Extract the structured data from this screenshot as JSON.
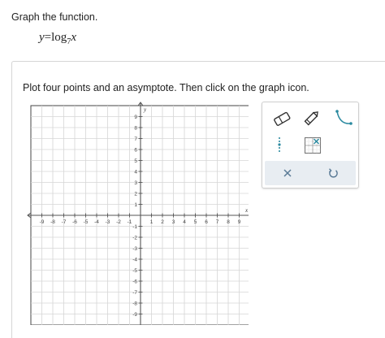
{
  "question": {
    "prompt": "Graph the function.",
    "equation": {
      "lhs": "y",
      "eq": "=",
      "func": "log",
      "base": "7",
      "arg": "x"
    }
  },
  "instruction": "Plot four points and an asymptote. Then click on the graph icon.",
  "graph": {
    "x_axis_label": "x",
    "y_axis_label": "y",
    "x_range": [
      -10,
      10
    ],
    "y_range": [
      -10,
      10
    ],
    "x_ticks": [
      "-9",
      "-8",
      "-7",
      "-6",
      "-5",
      "-4",
      "-3",
      "-2",
      "-1",
      "1",
      "2",
      "3",
      "4",
      "5",
      "6",
      "7",
      "8",
      "9"
    ],
    "y_ticks": [
      "9",
      "8",
      "7",
      "6",
      "5",
      "4",
      "3",
      "2",
      "1",
      "-1",
      "-2",
      "-3",
      "-4",
      "-5",
      "-6",
      "-7",
      "-8",
      "-9"
    ],
    "grid": true,
    "colors": {
      "grid": "#d6d6d6",
      "axis": "#555555",
      "tick_text": "#444444"
    }
  },
  "toolbox": {
    "tools": [
      "eraser-icon",
      "pencil-icon",
      "curve-tool-icon",
      "vertical-asymptote-icon",
      "graph-table-icon"
    ],
    "actions": [
      "clear-icon",
      "undo-icon"
    ],
    "colors": {
      "accent": "#2b8aa0",
      "bar": "#e8edf2",
      "action": "#5a7a96"
    }
  }
}
